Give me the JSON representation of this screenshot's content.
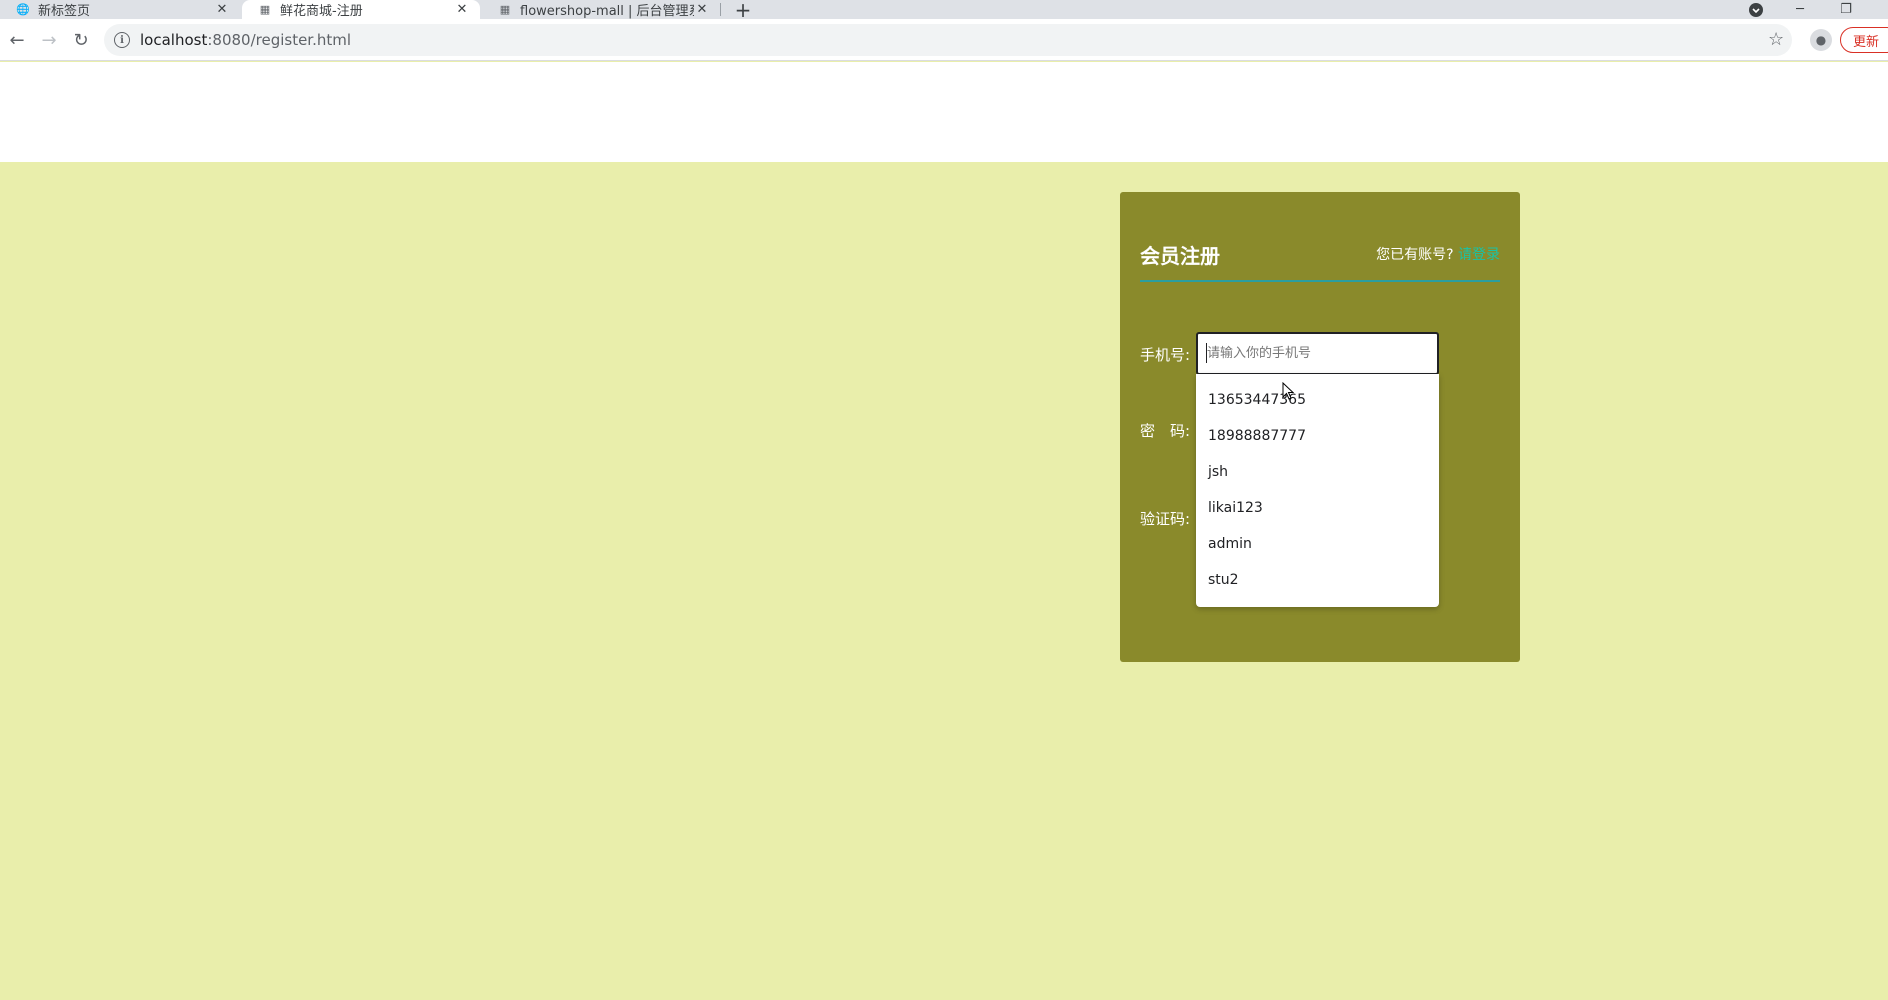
{
  "browser": {
    "tabs": [
      {
        "title": "新标签页",
        "icon": "globe-icon"
      },
      {
        "title": "鲜花商城-注册",
        "icon": "page-icon"
      },
      {
        "title": "flowershop-mall | 后台管理系统",
        "icon": "page-icon"
      }
    ],
    "new_tab_symbol": "+",
    "address": {
      "host": "localhost",
      "path": ":8080/register.html"
    },
    "update_label": "更新"
  },
  "register": {
    "title": "会员注册",
    "login_prompt": "您已有账号?",
    "login_link": "请登录",
    "phone_label": "手机号:",
    "phone_placeholder": "请输入你的手机号",
    "password_label": "密　码:",
    "captcha_label": "验证码:"
  },
  "autocomplete": {
    "items": [
      "13653447365",
      "18988887777",
      "jsh",
      "likai123",
      "admin",
      "stu2"
    ]
  },
  "colors": {
    "page_bg": "#e9eeab",
    "panel_bg": "#8a8a2b",
    "accent": "#2a9ea0",
    "link": "#19c3a7"
  }
}
